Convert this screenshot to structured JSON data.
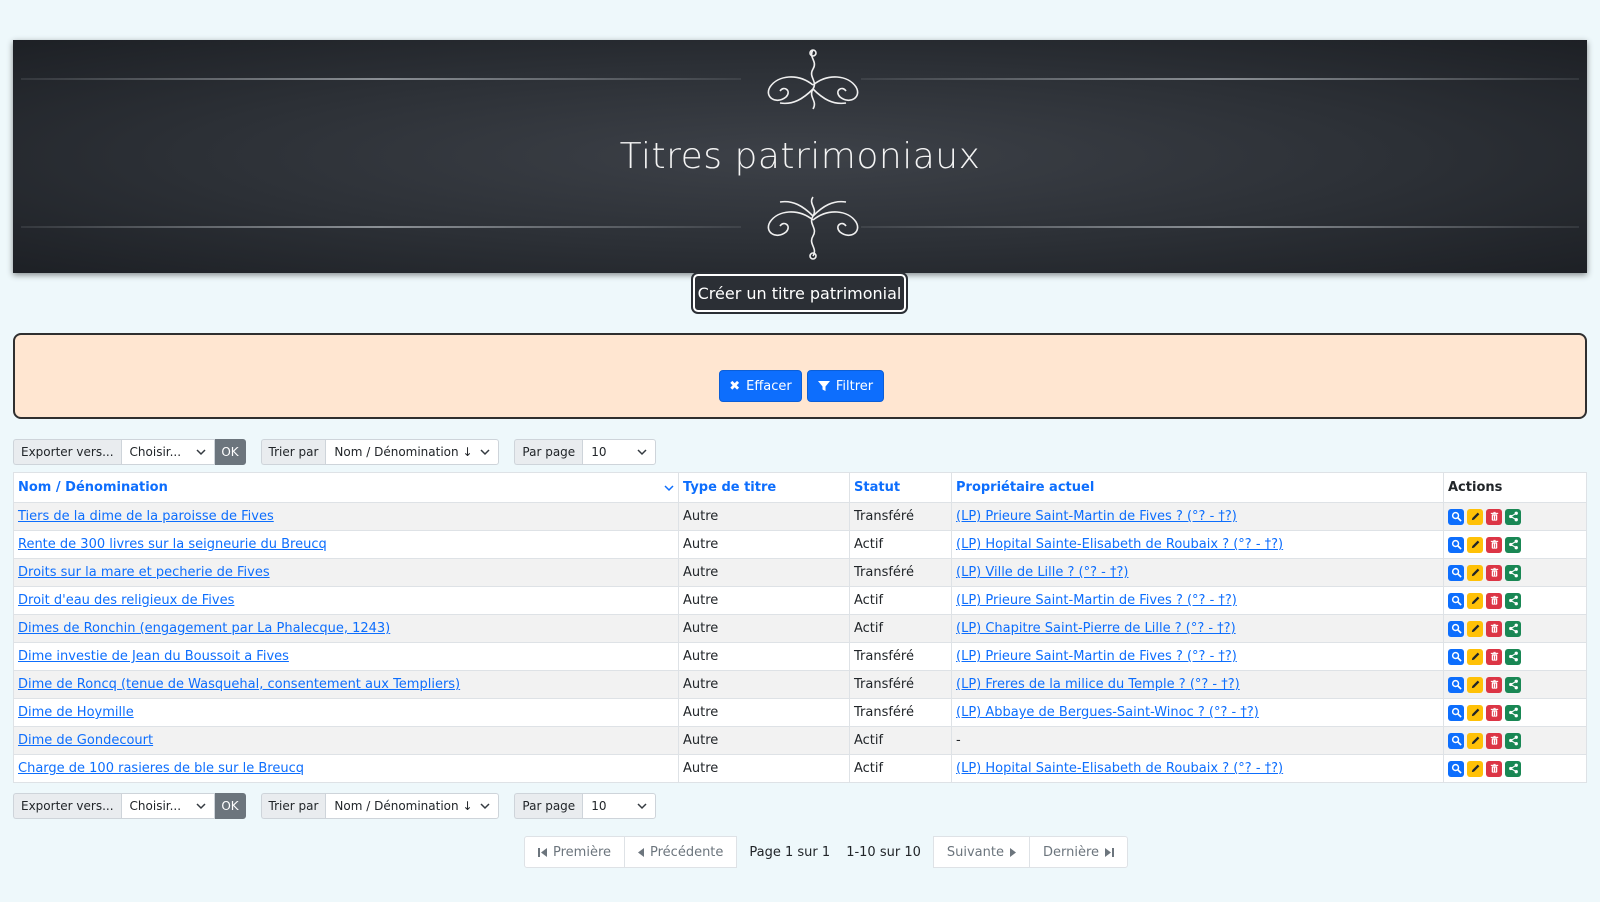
{
  "banner": {
    "title": "Titres patrimoniaux"
  },
  "create_button": {
    "label": "Créer un titre patrimonial"
  },
  "filter": {
    "clear_label": "Effacer",
    "filter_label": "Filtrer"
  },
  "toolbar": {
    "export_label": "Exporter vers...",
    "export_value": "Choisir...",
    "ok_label": "OK",
    "sort_label": "Trier par",
    "sort_value": "Nom / Dénomination ↓",
    "per_page_label": "Par page",
    "per_page_value": "10"
  },
  "table": {
    "headers": [
      "Nom / Dénomination",
      "Type de titre",
      "Statut",
      "Propriétaire actuel",
      "Actions"
    ],
    "rows": [
      {
        "name": "Tiers de la dime de la paroisse de Fives",
        "type": "Autre",
        "status": "Transféré",
        "owner": "(LP) Prieure Saint-Martin de Fives ? (°? - †?)"
      },
      {
        "name": "Rente de 300 livres sur la seigneurie du Breucq",
        "type": "Autre",
        "status": "Actif",
        "owner": "(LP) Hopital Sainte-Elisabeth de Roubaix ? (°? - †?)"
      },
      {
        "name": "Droits sur la mare et pecherie de Fives",
        "type": "Autre",
        "status": "Transféré",
        "owner": "(LP) Ville de Lille ? (°? - †?)"
      },
      {
        "name": "Droit d'eau des religieux de Fives",
        "type": "Autre",
        "status": "Actif",
        "owner": "(LP) Prieure Saint-Martin de Fives ? (°? - †?)"
      },
      {
        "name": "Dimes de Ronchin (engagement par La Phalecque, 1243)",
        "type": "Autre",
        "status": "Actif",
        "owner": "(LP) Chapitre Saint-Pierre de Lille ? (°? - †?)"
      },
      {
        "name": "Dime investie de Jean du Boussoit a Fives",
        "type": "Autre",
        "status": "Transféré",
        "owner": "(LP) Prieure Saint-Martin de Fives ? (°? - †?)"
      },
      {
        "name": "Dime de Roncq (tenue de Wasquehal, consentement aux Templiers)",
        "type": "Autre",
        "status": "Transféré",
        "owner": "(LP) Freres de la milice du Temple ? (°? - †?)"
      },
      {
        "name": "Dime de Hoymille",
        "type": "Autre",
        "status": "Transféré",
        "owner": "(LP) Abbaye de Bergues-Saint-Winoc ? (°? - †?)"
      },
      {
        "name": "Dime de Gondecourt",
        "type": "Autre",
        "status": "Actif",
        "owner": "-"
      },
      {
        "name": "Charge de 100 rasieres de ble sur le Breucq",
        "type": "Autre",
        "status": "Actif",
        "owner": "(LP) Hopital Sainte-Elisabeth de Roubaix ? (°? - †?)"
      }
    ]
  },
  "pagination": {
    "first": "Première",
    "prev": "Précédente",
    "page_info": "Page 1 sur 1",
    "range_info": "1-10 sur 10",
    "next": "Suivante",
    "last": "Dernière"
  }
}
